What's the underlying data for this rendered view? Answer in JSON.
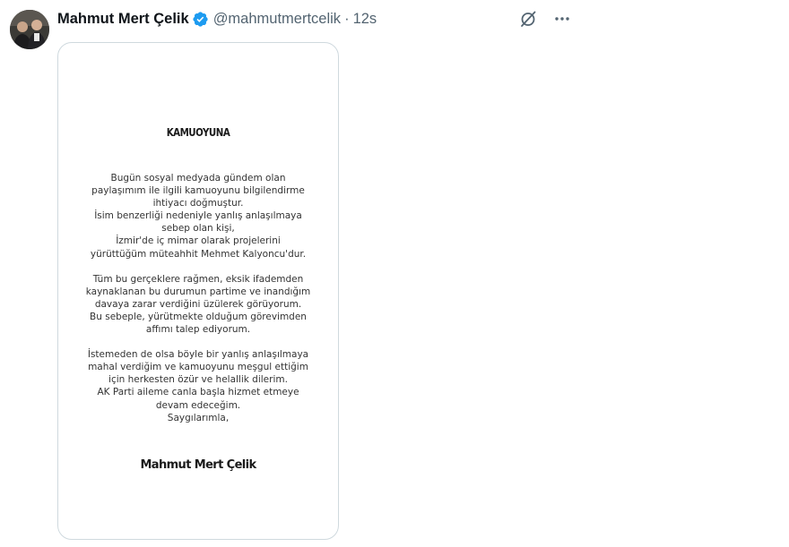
{
  "author": {
    "display_name": "Mahmut Mert Çelik",
    "handle": "@mahmutmertcelik",
    "separator": "·",
    "timestamp": "12s",
    "verified": true,
    "verified_color": "#1d9bf0"
  },
  "icons": {
    "avatar": "profile-photo",
    "verified": "verified-badge-icon",
    "grok": "grok-icon",
    "more": "more-icon"
  },
  "media": {
    "title": "KAMUOYUNA",
    "paragraphs": [
      [
        "Bugün sosyal medyada gündem olan",
        "paylaşımım ile ilgili kamuoyunu bilgilendirme",
        "ihtiyacı doğmuştur.",
        "İsim benzerliği nedeniyle yanlış anlaşılmaya",
        "sebep olan kişi,",
        "İzmir'de iç mimar olarak projelerini",
        "yürüttüğüm müteahhit Mehmet Kalyoncu'dur."
      ],
      [
        "Tüm bu gerçeklere rağmen, eksik ifademden",
        "kaynaklanan bu durumun partime ve inandığım",
        "davaya zarar verdiğini üzülerek görüyorum.",
        "Bu sebeple, yürütmekte olduğum görevimden",
        "affımı talep ediyorum."
      ],
      [
        "İstemeden de olsa böyle bir yanlış anlaşılmaya",
        "mahal verdiğim ve kamuoyunu meşgul ettiğim",
        "için herkesten özür ve helallik dilerim.",
        "AK Parti aileme canla başla hizmet etmeye",
        "devam edeceğim.",
        "Saygılarımla,"
      ]
    ],
    "signature": "Mahmut Mert Çelik"
  }
}
